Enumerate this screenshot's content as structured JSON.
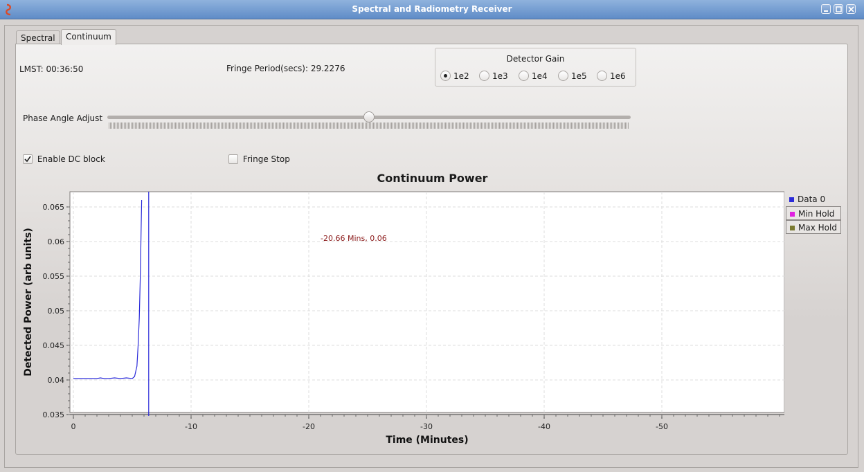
{
  "window": {
    "title": "Spectral and Radiometry Receiver",
    "app_icon": "gnuradio-icon",
    "controls": [
      "minimize-icon",
      "maximize-icon",
      "close-icon"
    ]
  },
  "tabs": [
    {
      "label": "Spectral",
      "active": false
    },
    {
      "label": "Continuum",
      "active": true
    }
  ],
  "status": {
    "lmst": "LMST: 00:36:50",
    "fringe_period": "Fringe Period(secs): 29.2276"
  },
  "detector_gain": {
    "title": "Detector Gain",
    "options": [
      "1e2",
      "1e3",
      "1e4",
      "1e5",
      "1e6"
    ],
    "selected": "1e2"
  },
  "phase_angle": {
    "label": "Phase Angle Adjust",
    "value_fraction": 0.5
  },
  "checks": {
    "dc_block": {
      "label": "Enable DC block",
      "checked": true
    },
    "fringe_stop": {
      "label": "Fringe Stop",
      "checked": false
    }
  },
  "chart_data": {
    "type": "line",
    "title": "Continuum Power",
    "xlabel": "Time (Minutes)",
    "ylabel": "Detected Power (arb units)",
    "xlim": [
      0,
      -60
    ],
    "ylim": [
      0.0345,
      0.066
    ],
    "xticks": [
      0,
      -10,
      -20,
      -30,
      -40,
      -50
    ],
    "xtick_labels": [
      "0",
      "-10",
      "-20",
      "-30",
      "-40",
      "-50"
    ],
    "yticks": [
      0.035,
      0.04,
      0.045,
      0.05,
      0.055,
      0.06,
      0.065
    ],
    "ytick_labels": [
      "0.035",
      "0.04",
      "0.045",
      "0.05",
      "0.055",
      "0.06",
      "0.065"
    ],
    "grid": true,
    "annotation": "-20.66 Mins, 0.06",
    "legend": [
      "Data 0",
      "Min Hold",
      "Max Hold"
    ],
    "legend_position": "right",
    "series": [
      {
        "name": "Data 0",
        "color": "#2b2bd9",
        "x": [
          0,
          -1,
          -2,
          -2.3,
          -2.6,
          -3,
          -3.5,
          -4,
          -4.5,
          -5,
          -5.2,
          -5.4,
          -5.5,
          -5.6,
          -5.7,
          -5.75,
          -5.8
        ],
        "y": [
          0.0402,
          0.0402,
          0.0402,
          0.0403,
          0.0402,
          0.0402,
          0.0403,
          0.0402,
          0.0403,
          0.0402,
          0.0405,
          0.042,
          0.045,
          0.049,
          0.056,
          0.0615,
          0.066
        ]
      },
      {
        "name": "Min Hold",
        "color": "#e020e0",
        "x": [],
        "y": []
      },
      {
        "name": "Max Hold",
        "color": "#7a7a30",
        "x": [],
        "y": []
      }
    ],
    "marker_line": {
      "x": -6.4,
      "color": "#2b2bd9"
    }
  }
}
